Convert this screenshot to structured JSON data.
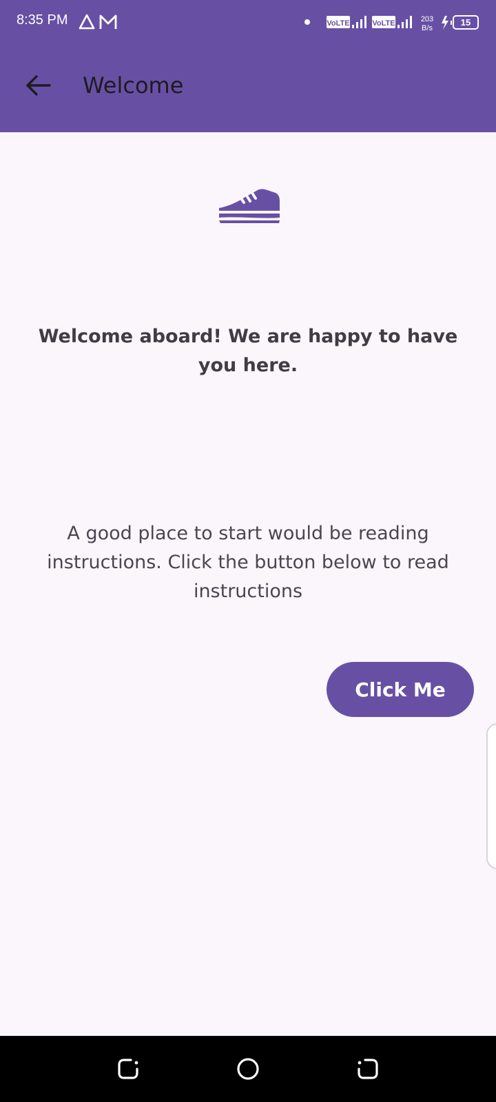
{
  "status_bar": {
    "time": "8:35 PM",
    "left_icons": [
      "app-notification-icon",
      "gmail-icon"
    ],
    "right_icons": [
      "dot-icon",
      "volte-signal-icon",
      "volte-signal-icon",
      "charging-icon",
      "battery-icon"
    ],
    "network_speed_value": "203",
    "network_speed_unit": "B/s",
    "battery_level": "15",
    "volte_label": "VoLTE"
  },
  "app_bar": {
    "title": "Welcome",
    "back_icon": "arrow-back-icon"
  },
  "main": {
    "hero_icon": "shoe-icon",
    "welcome_text": "Welcome aboard! We are happy to have you here.",
    "instructions_text": "A good place to start would be reading instructions. Click the button below to read instructions",
    "button_label": "Click Me"
  },
  "nav_bar": {
    "icons": [
      "recents-icon",
      "home-icon",
      "back-icon"
    ]
  },
  "colors": {
    "primary": "#6750A4",
    "background": "#FBF5FC",
    "text_dark": "#403B45",
    "nav_bar": "#000000"
  }
}
